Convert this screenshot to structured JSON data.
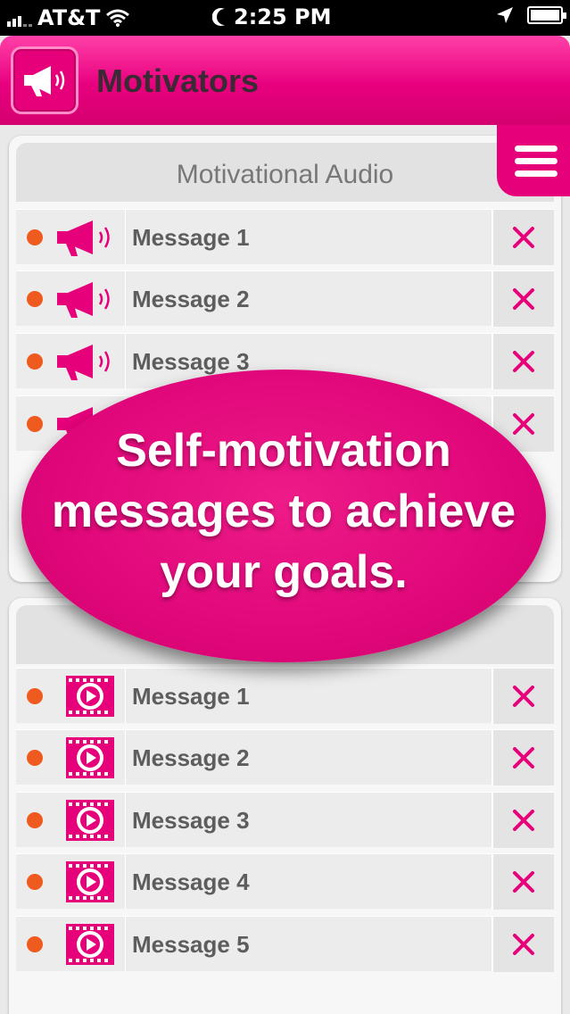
{
  "status_bar": {
    "carrier": "AT&T",
    "time": "2:25 PM"
  },
  "header": {
    "title": "Motivators",
    "logo_icon": "megaphone-icon",
    "menu_icon": "hamburger-menu-icon"
  },
  "audio_section": {
    "title": "Motivational Audio",
    "items": [
      {
        "label": "Message 1"
      },
      {
        "label": "Message 2"
      },
      {
        "label": "Message 3"
      },
      {
        "label": ""
      }
    ]
  },
  "video_section": {
    "title": "",
    "items": [
      {
        "label": "Message 1"
      },
      {
        "label": "Message 2"
      },
      {
        "label": "Message 3"
      },
      {
        "label": "Message 4"
      },
      {
        "label": "Message 5"
      }
    ]
  },
  "overlay": {
    "line1": "Self-motivation",
    "line2": "messages to achieve",
    "line3": "your goals."
  },
  "colors": {
    "accent": "#e6007a",
    "dot": "#ef5a1f"
  }
}
